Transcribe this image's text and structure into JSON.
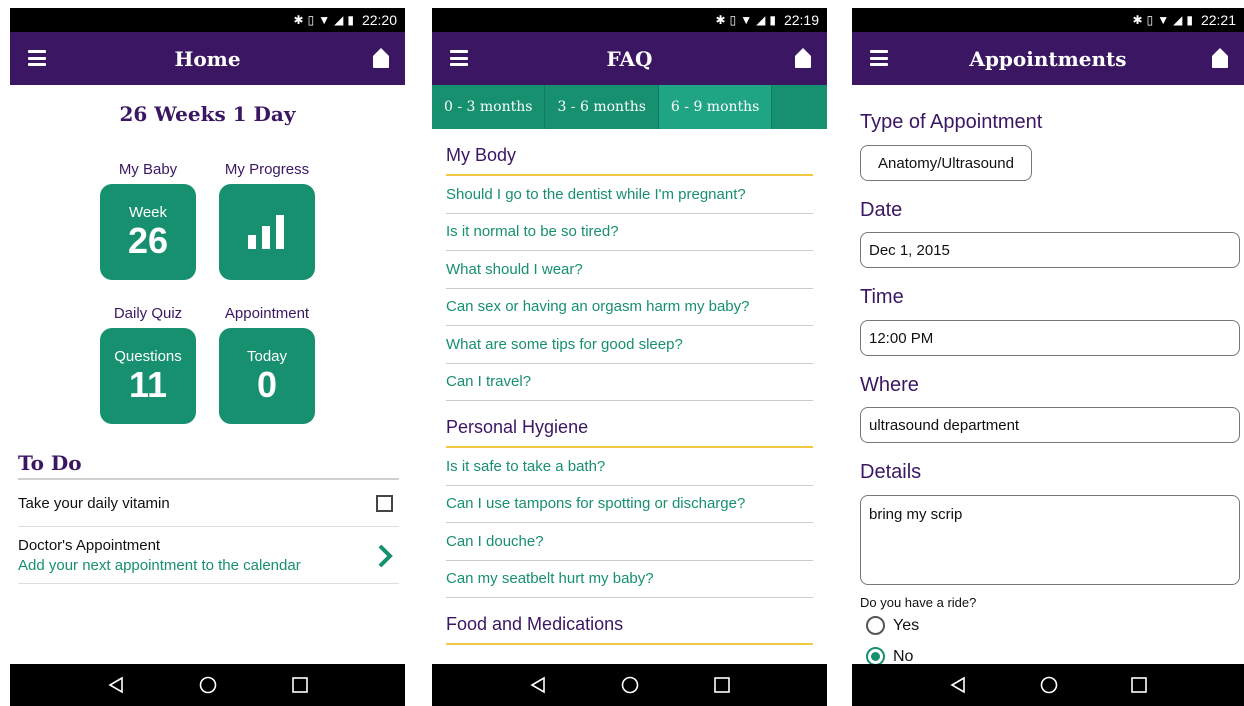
{
  "home": {
    "status_time": "22:20",
    "title": "Home",
    "weeks_title": "26 Weeks 1 Day",
    "tiles": [
      {
        "label": "My Baby",
        "small": "Week",
        "big": "26"
      },
      {
        "label": "My Progress",
        "icon": "bar-chart-icon"
      },
      {
        "label": "Daily Quiz",
        "small": "Questions",
        "big": "11"
      },
      {
        "label": "Appointment",
        "small": "Today",
        "big": "0"
      }
    ],
    "todo_title": "To Do",
    "todo_items": [
      {
        "text": "Take your daily vitamin",
        "checked": false
      },
      {
        "title": "Doctor's Appointment",
        "subtitle": "Add your next appointment to the calendar"
      }
    ]
  },
  "faq": {
    "status_time": "22:19",
    "title": "FAQ",
    "tabs": [
      "0 - 3 months",
      "3 - 6 months",
      "6 - 9 months"
    ],
    "active_tab": "6 - 9 months",
    "sections": [
      {
        "heading": "My Body",
        "items": [
          "Should I go to the dentist while I'm pregnant?",
          "Is it normal to be so tired?",
          "What should I wear?",
          "Can sex or having an orgasm harm my baby?",
          "What are some tips for good sleep?",
          "Can I travel?"
        ]
      },
      {
        "heading": "Personal Hygiene",
        "items": [
          "Is it safe to take a bath?",
          "Can I use tampons for spotting or discharge?",
          "Can I douche?",
          "Can my seatbelt hurt my baby?"
        ]
      },
      {
        "heading": "Food and Medications",
        "items": []
      }
    ]
  },
  "appointments": {
    "status_time": "22:21",
    "title": "Appointments",
    "type_label": "Type of Appointment",
    "type_value": "Anatomy/Ultrasound",
    "date_label": "Date",
    "date_value": "Dec 1, 2015",
    "time_label": "Time",
    "time_value": "12:00 PM",
    "where_label": "Where",
    "where_value": "ultrasound department",
    "details_label": "Details",
    "details_value": "bring my scrip",
    "ride_question": "Do you have a ride?",
    "ride_options": [
      "Yes",
      "No"
    ],
    "ride_selected": "No"
  },
  "colors": {
    "primary": "#3b1763",
    "accent": "#17906f",
    "divider": "#f2c744"
  }
}
